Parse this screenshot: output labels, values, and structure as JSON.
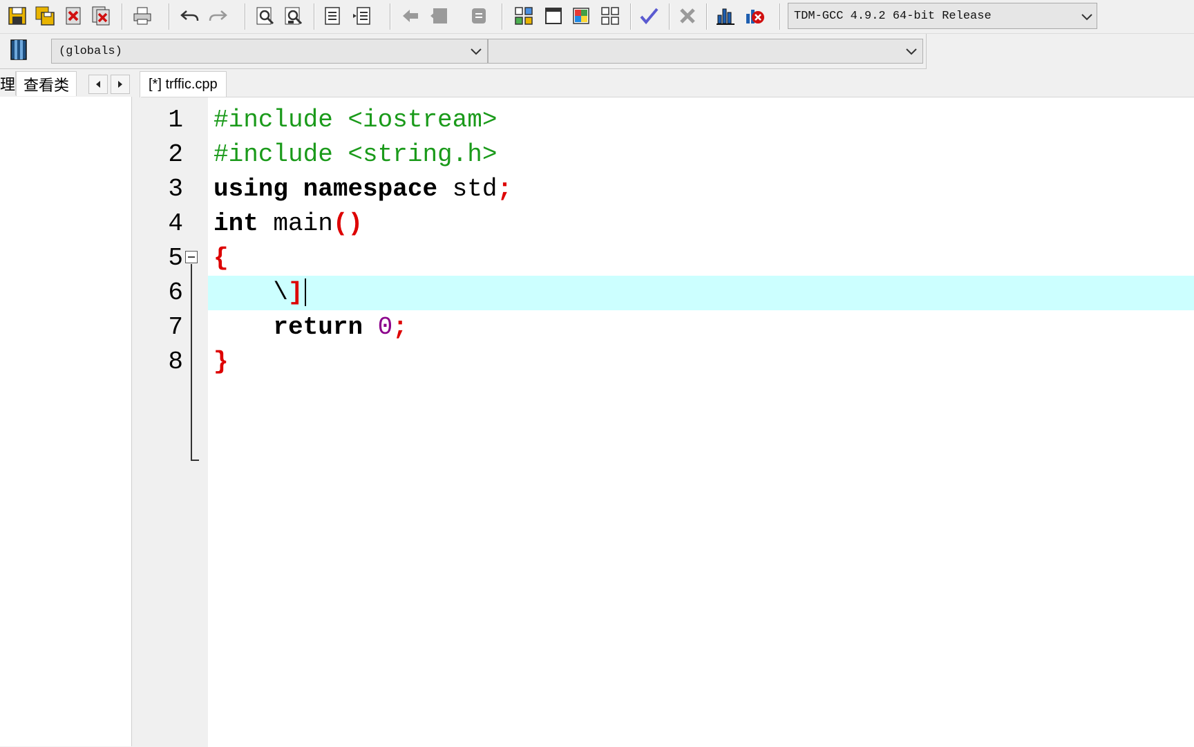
{
  "toolbar": {
    "compiler_select": "TDM-GCC 4.9.2 64-bit Release"
  },
  "toolbar2": {
    "scope_select": "(globals)",
    "member_select": ""
  },
  "left_panel": {
    "tabs": [
      {
        "label": "理"
      },
      {
        "label": "查看类"
      }
    ]
  },
  "editor": {
    "file_tab": "[*] trffic.cpp",
    "line_numbers": [
      "1",
      "2",
      "3",
      "4",
      "5",
      "6",
      "7",
      "8"
    ],
    "lines": [
      [
        {
          "t": "pre",
          "v": "#include <iostream>"
        }
      ],
      [
        {
          "t": "pre",
          "v": "#include <string.h>"
        }
      ],
      [
        {
          "t": "kw",
          "v": "using"
        },
        {
          "t": "txt",
          "v": " "
        },
        {
          "t": "kw",
          "v": "namespace"
        },
        {
          "t": "txt",
          "v": " std"
        },
        {
          "t": "sym",
          "v": ";"
        }
      ],
      [
        {
          "t": "kw",
          "v": "int"
        },
        {
          "t": "txt",
          "v": " main"
        },
        {
          "t": "sym",
          "v": "()"
        }
      ],
      [
        {
          "t": "sym",
          "v": "{"
        }
      ],
      [
        {
          "t": "txt",
          "v": "    \\"
        },
        {
          "t": "sym",
          "v": "]"
        }
      ],
      [
        {
          "t": "txt",
          "v": "    "
        },
        {
          "t": "kw",
          "v": "return"
        },
        {
          "t": "txt",
          "v": " "
        },
        {
          "t": "num",
          "v": "0"
        },
        {
          "t": "sym",
          "v": ";"
        }
      ],
      [
        {
          "t": "sym",
          "v": "}"
        }
      ]
    ],
    "current_line": 6
  },
  "colors": {
    "preprocessor": "#1a9a1a",
    "symbol": "#dd0000",
    "number": "#8b008b",
    "current_line_bg": "#ccffff"
  },
  "icons": [
    "save-icon",
    "save-all-icon",
    "close-icon",
    "close-all-icon",
    "print-icon",
    "undo-icon",
    "redo-icon",
    "find-icon",
    "replace-icon",
    "indent-icon",
    "unindent-icon",
    "back-icon",
    "forward-icon",
    "bookmark-icon",
    "new-class-icon",
    "window-icon",
    "color-icon",
    "grid-icon",
    "check-syntax-icon",
    "stop-icon",
    "chart-icon",
    "profile-icon",
    "class-browser-icon"
  ]
}
